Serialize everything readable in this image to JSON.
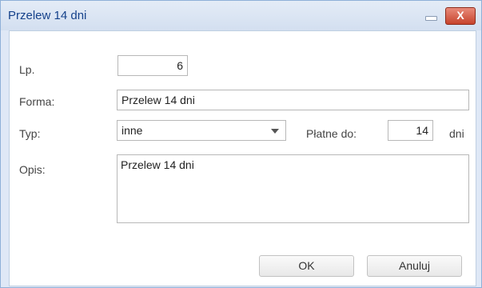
{
  "window": {
    "title": "Przelew 14 dni",
    "close_glyph": "X"
  },
  "form": {
    "lp": {
      "label": "Lp.",
      "value": "6"
    },
    "forma": {
      "label": "Forma:",
      "value": "Przelew 14 dni"
    },
    "typ": {
      "label": "Typ:",
      "value": "inne"
    },
    "platne_do": {
      "label": "Płatne do:",
      "value": "14",
      "unit": "dni"
    },
    "opis": {
      "label": "Opis:",
      "value": "Przelew 14 dni"
    }
  },
  "buttons": {
    "ok": "OK",
    "cancel": "Anuluj"
  },
  "icons": [
    "minimize-icon",
    "close-icon",
    "chevron-down-icon"
  ]
}
